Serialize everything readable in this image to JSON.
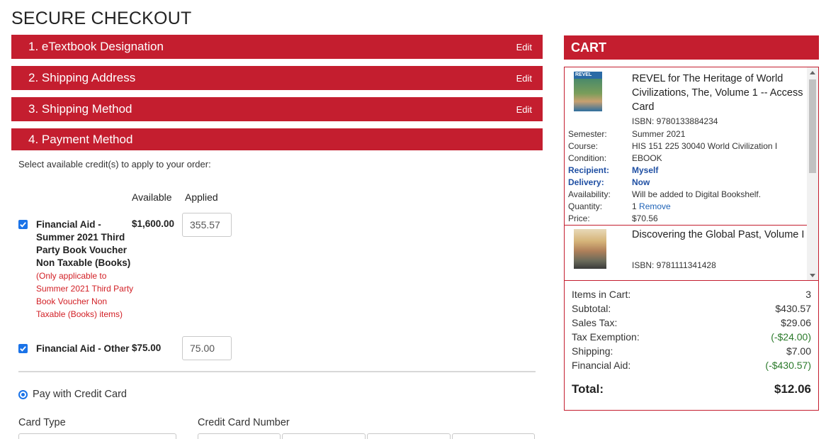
{
  "page": {
    "title": "SECURE CHECKOUT"
  },
  "steps": [
    {
      "label": "1. eTextbook Designation",
      "edit": "Edit"
    },
    {
      "label": "2. Shipping Address",
      "edit": "Edit"
    },
    {
      "label": "3. Shipping Method",
      "edit": "Edit"
    },
    {
      "label": "4. Payment Method"
    }
  ],
  "payment": {
    "intro": "Select available credit(s) to apply to your order:",
    "col_available": "Available",
    "col_applied": "Applied",
    "credits": [
      {
        "checked": true,
        "name": "Financial Aid - Summer 2021 Third Party Book Voucher Non Taxable (Books)",
        "note": "(Only applicable to Summer 2021 Third Party Book Voucher Non Taxable (Books) items)",
        "available": "$1,600.00",
        "applied": "355.57"
      },
      {
        "checked": true,
        "name": "Financial Aid - Other",
        "available": "$75.00",
        "applied": "75.00"
      }
    ],
    "pay_with_card_label": "Pay with Credit Card",
    "card_type_label": "Card Type",
    "card_number_label": "Credit Card Number"
  },
  "cart": {
    "header": "CART",
    "items": [
      {
        "cover_tag": "REVEL",
        "title": "REVEL for The Heritage of World Civilizations, The, Volume 1 -- Access Card",
        "isbn": "ISBN: 9780133884234",
        "details": [
          {
            "key": "Semester:",
            "value": "Summer 2021"
          },
          {
            "key": "Course:",
            "value": "HIS 151 225 30040 World Civilization I"
          },
          {
            "key": "Condition:",
            "value": "EBOOK"
          },
          {
            "key": "Recipient:",
            "value": "Myself"
          },
          {
            "key": "Delivery:",
            "value": "Now"
          },
          {
            "key": "Availability:",
            "value": "Will be added to Digital Bookshelf."
          },
          {
            "key": "Quantity:",
            "value": "1",
            "link": "Remove"
          },
          {
            "key": "Price:",
            "value": "$70.56"
          }
        ]
      },
      {
        "title": "Discovering the Global Past, Volume I",
        "isbn": "ISBN: 9781111341428"
      }
    ],
    "summary": [
      {
        "key": "Items in Cart:",
        "value": "3"
      },
      {
        "key": "Subtotal:",
        "value": "$430.57"
      },
      {
        "key": "Sales Tax:",
        "value": "$29.06"
      },
      {
        "key": "Tax Exemption:",
        "value": "(-$24.00)"
      },
      {
        "key": "Shipping:",
        "value": "$7.00"
      },
      {
        "key": "Financial Aid:",
        "value": "(-$430.57)"
      }
    ],
    "total": {
      "key": "Total:",
      "value": "$12.06"
    },
    "colors": {
      "accent": "#c41e2f",
      "credit": "#2b7a2b",
      "link": "#1f63b7"
    }
  }
}
